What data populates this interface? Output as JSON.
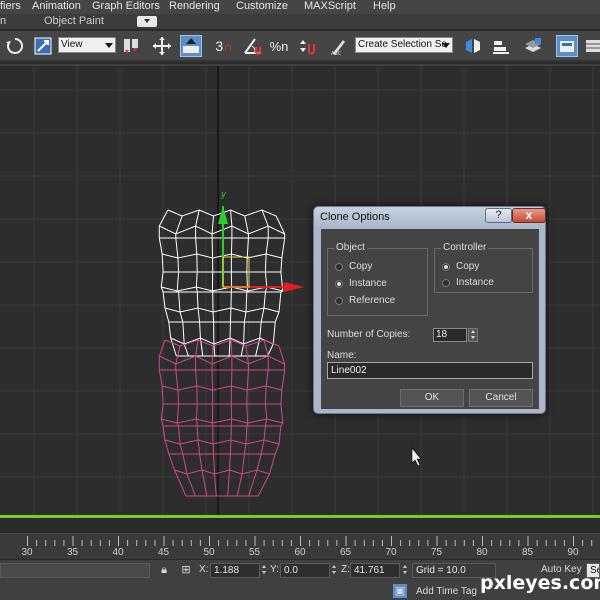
{
  "menubar": {
    "items": [
      "fiers",
      "Animation",
      "Graph Editors",
      "Rendering",
      "Customize",
      "MAXScript",
      "Help"
    ]
  },
  "ribbon": {
    "items": [
      "n",
      "Object Paint"
    ]
  },
  "toolbar": {
    "view_select": "View",
    "selection_set": "Create Selection Se",
    "snap_value": "3",
    "percent_snap": "%n"
  },
  "viewport": {
    "axis_label": "y",
    "colors": {
      "background": "#2d2d2d",
      "grid": "#3b3b3b",
      "axis_line": "#111111",
      "wire_selected": "#ffffff",
      "wire_clone": "#d1478e",
      "gizmo_y": "#2bcc2b",
      "gizmo_x": "#e02020",
      "active_border": "#6fd02f"
    }
  },
  "dialog": {
    "title": "Clone Options",
    "help_label": "?",
    "close_label": "x",
    "object_group": {
      "label": "Object",
      "options": [
        {
          "label": "Copy",
          "selected": false
        },
        {
          "label": "Instance",
          "selected": true
        },
        {
          "label": "Reference",
          "selected": false
        }
      ]
    },
    "controller_group": {
      "label": "Controller",
      "options": [
        {
          "label": "Copy",
          "selected": true
        },
        {
          "label": "Instance",
          "selected": false
        }
      ]
    },
    "copies_label": "Number of Copies:",
    "copies_value": "18",
    "name_label": "Name:",
    "name_value": "Line002",
    "ok_label": "OK",
    "cancel_label": "Cancel"
  },
  "timeline": {
    "ticks": [
      "30",
      "35",
      "40",
      "45",
      "50",
      "55",
      "60",
      "65",
      "70",
      "75",
      "80",
      "85",
      "90"
    ]
  },
  "status": {
    "x_label": "X:",
    "x_value": "1.188",
    "y_label": "Y:",
    "y_value": "0.0",
    "z_label": "Z:",
    "z_value": "41.761",
    "grid_label": "Grid = 10.0",
    "auto_key": "Auto Key",
    "selected_stub": "Sele",
    "add_time_tag": "Add Time Tag"
  },
  "watermark": "pxleyes.com"
}
